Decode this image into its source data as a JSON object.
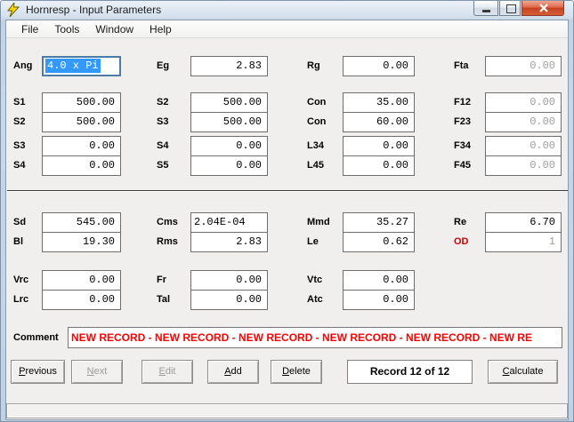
{
  "window": {
    "title": "Hornresp - Input Parameters",
    "app_icon": "lightning-bolt-icon",
    "controls": {
      "minimize": "minimize",
      "maximize": "maximize",
      "close": "close"
    }
  },
  "menu": {
    "items": [
      {
        "label": "File"
      },
      {
        "label": "Tools"
      },
      {
        "label": "Window"
      },
      {
        "label": "Help"
      }
    ]
  },
  "params": {
    "top_grid": {
      "rows": [
        {
          "cells": [
            {
              "label": "Ang",
              "value": "4.0 x Pi",
              "selected": true
            },
            {
              "label": "Eg",
              "value": "2.83"
            },
            {
              "label": "Rg",
              "value": "0.00"
            },
            {
              "label": "Fta",
              "value": "0.00",
              "disabled": true
            }
          ]
        },
        {
          "cells": [
            {
              "label": "S1",
              "value": "500.00"
            },
            {
              "label": "S2",
              "value": "500.00"
            },
            {
              "label": "Con",
              "value": "35.00"
            },
            {
              "label": "F12",
              "value": "0.00",
              "disabled": true
            }
          ]
        },
        {
          "cells": [
            {
              "label": "S2",
              "value": "500.00"
            },
            {
              "label": "S3",
              "value": "500.00"
            },
            {
              "label": "Con",
              "value": "60.00"
            },
            {
              "label": "F23",
              "value": "0.00",
              "disabled": true
            }
          ]
        },
        {
          "cells": [
            {
              "label": "S3",
              "value": "0.00"
            },
            {
              "label": "S4",
              "value": "0.00"
            },
            {
              "label": "L34",
              "value": "0.00"
            },
            {
              "label": "F34",
              "value": "0.00",
              "disabled": true
            }
          ]
        },
        {
          "cells": [
            {
              "label": "S4",
              "value": "0.00"
            },
            {
              "label": "S5",
              "value": "0.00"
            },
            {
              "label": "L45",
              "value": "0.00"
            },
            {
              "label": "F45",
              "value": "0.00",
              "disabled": true
            }
          ]
        }
      ]
    },
    "driver_grid": {
      "rows": [
        {
          "cells": [
            {
              "label": "Sd",
              "value": "545.00"
            },
            {
              "label": "Cms",
              "value": "2.04E-04"
            },
            {
              "label": "Mmd",
              "value": "35.27"
            },
            {
              "label": "Re",
              "value": "6.70"
            }
          ]
        },
        {
          "cells": [
            {
              "label": "Bl",
              "value": "19.30"
            },
            {
              "label": "Rms",
              "value": "2.83"
            },
            {
              "label": "Le",
              "value": "0.62"
            },
            {
              "label": "OD",
              "value": "1",
              "disabled": true,
              "label_color": "red"
            }
          ]
        }
      ]
    },
    "chamber_grid": {
      "rows": [
        {
          "cells": [
            {
              "label": "Vrc",
              "value": "0.00"
            },
            {
              "label": "Fr",
              "value": "0.00"
            },
            {
              "label": "Vtc",
              "value": "0.00"
            }
          ]
        },
        {
          "cells": [
            {
              "label": "Lrc",
              "value": "0.00"
            },
            {
              "label": "Tal",
              "value": "0.00"
            },
            {
              "label": "Atc",
              "value": "0.00"
            }
          ]
        }
      ]
    }
  },
  "comment": {
    "label": "Comment",
    "value": "NEW RECORD - NEW RECORD - NEW RECORD - NEW RECORD - NEW RECORD - NEW RE"
  },
  "footer": {
    "buttons": [
      {
        "label": "Previous",
        "enabled": true
      },
      {
        "label": "Next",
        "enabled": false
      },
      {
        "label": "Edit",
        "enabled": false
      },
      {
        "label": "Add",
        "enabled": true
      },
      {
        "label": "Delete",
        "enabled": true
      },
      {
        "label": "Calculate",
        "enabled": true
      }
    ],
    "record_status": "Record 12 of 12"
  },
  "status_bar": {
    "text": ""
  },
  "colors": {
    "selection_blue": "#3399FF",
    "comment_red": "#FF0000",
    "od_label_red": "#CC0000",
    "disabled_text": "#9E9E9E"
  }
}
